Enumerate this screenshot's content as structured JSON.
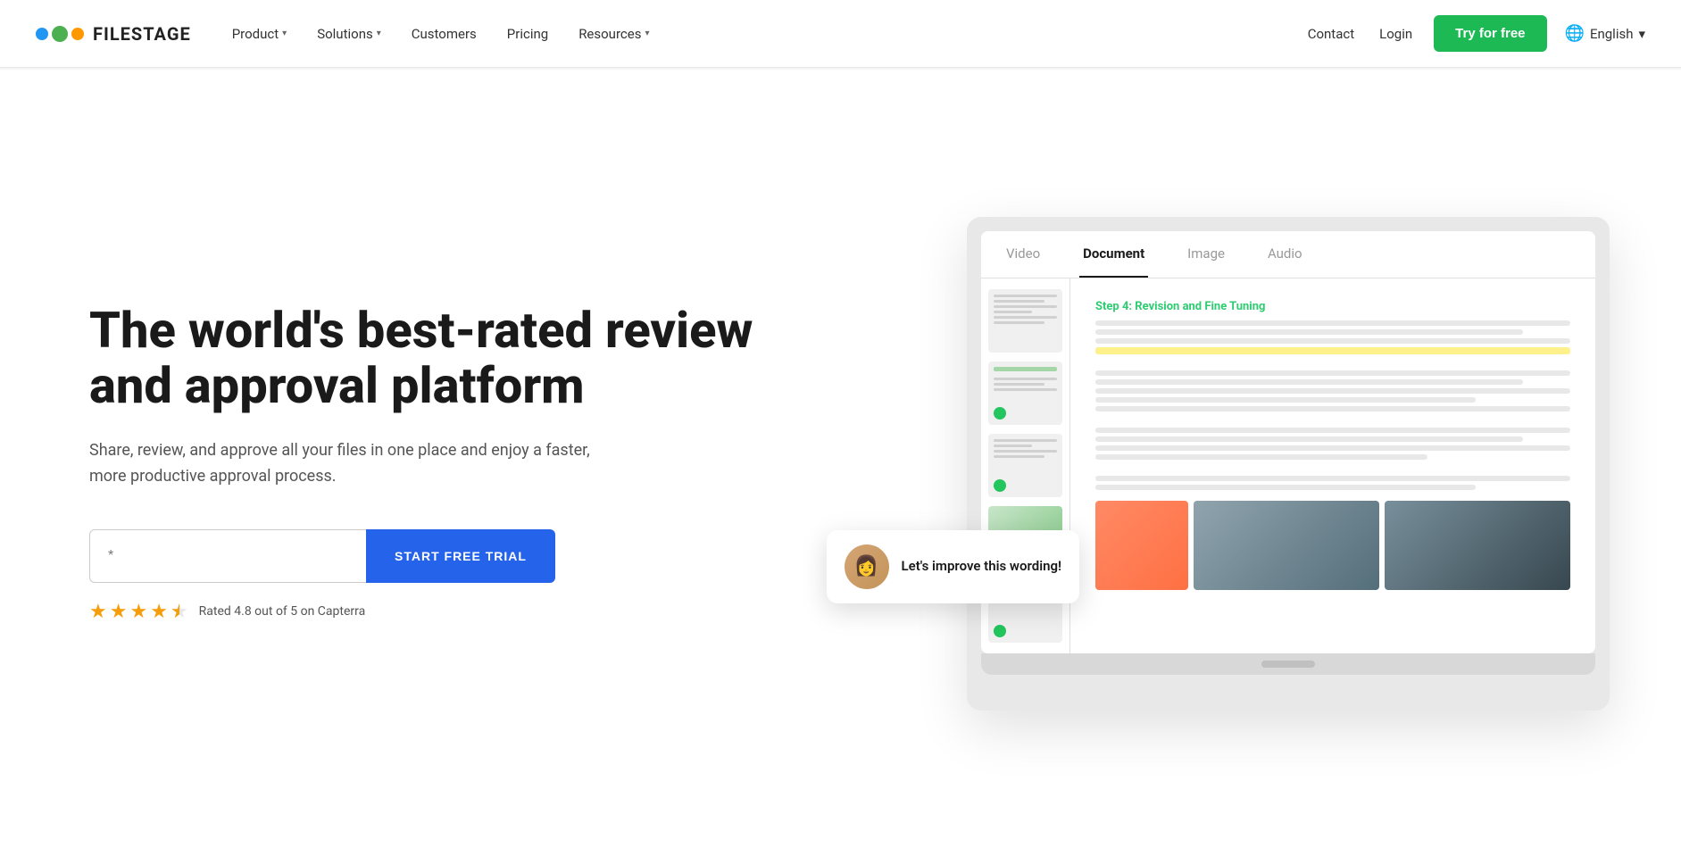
{
  "brand": {
    "name": "FILESTAGE"
  },
  "navbar": {
    "nav_items": [
      {
        "id": "product",
        "label": "Product",
        "has_dropdown": true
      },
      {
        "id": "solutions",
        "label": "Solutions",
        "has_dropdown": true
      },
      {
        "id": "customers",
        "label": "Customers",
        "has_dropdown": false
      },
      {
        "id": "pricing",
        "label": "Pricing",
        "has_dropdown": false
      },
      {
        "id": "resources",
        "label": "Resources",
        "has_dropdown": true
      }
    ],
    "contact_label": "Contact",
    "login_label": "Login",
    "try_label": "Try for free",
    "lang_label": "English"
  },
  "hero": {
    "title": "The world's best-rated review and approval platform",
    "subtitle": "Share, review, and approve all your files in one place and enjoy a faster, more productive approval process.",
    "email_placeholder": "*",
    "cta_button": "START FREE TRIAL",
    "rating_text": "Rated 4.8 out of 5 on Capterra",
    "rating_value": "4.8",
    "star_count": 4,
    "has_half_star": true
  },
  "mockup": {
    "tabs": [
      {
        "id": "video",
        "label": "Video",
        "active": false
      },
      {
        "id": "document",
        "label": "Document",
        "active": true
      },
      {
        "id": "image",
        "label": "Image",
        "active": false
      },
      {
        "id": "audio",
        "label": "Audio",
        "active": false
      }
    ],
    "comment": {
      "text": "Let's improve this wording!",
      "avatar_emoji": "👩"
    },
    "doc_title": "Step 4: Revision and Fine Tuning"
  }
}
